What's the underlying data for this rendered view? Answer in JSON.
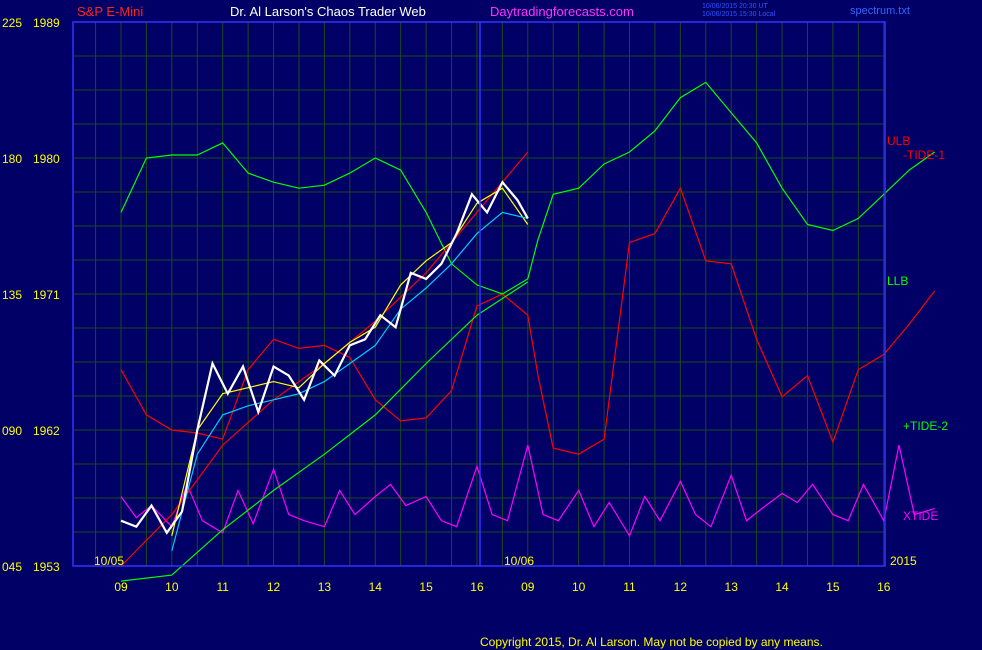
{
  "header": {
    "instrument": "S&P E-Mini",
    "site_title": "Dr. Al Larson's Chaos Trader Web",
    "site_url": "Daytradingforecasts.com",
    "timestamp_utc": "10/06/2015 20:30 UT",
    "timestamp_local": "10/06/2015 15:30 Local",
    "filename": "spectrum.txt"
  },
  "footer": {
    "copyright": "Copyright 2015, Dr. Al Larson. May not be copied by any means."
  },
  "colors": {
    "background": "#000066",
    "plot_border": "#3333ff",
    "grid": "#1c4a1c",
    "tick_label": "#ffff00",
    "price_bars": "#ffffff",
    "tide1": "#ff0000",
    "tide2": "#00ff00",
    "xtide": "#ff00ff",
    "ma_fast": "#ffff00",
    "ma_slow": "#00ccff"
  },
  "chart_data": {
    "type": "line",
    "title": "S&P E-Mini",
    "y_left_outer": {
      "ticks": [
        "225",
        "180",
        "135",
        "090",
        "045"
      ],
      "range": [
        45,
        225
      ]
    },
    "y_left_inner": {
      "ticks": [
        "1989",
        "1980",
        "1971",
        "1962",
        "1953"
      ],
      "range": [
        1953,
        1989
      ]
    },
    "x_ticks": [
      "09",
      "10",
      "11",
      "12",
      "13",
      "14",
      "15",
      "16",
      "09",
      "10",
      "11",
      "12",
      "13",
      "14",
      "15",
      "16"
    ],
    "date_labels": {
      "start": "10/05",
      "divider": "10/06",
      "end": "2015"
    },
    "line_labels": [
      {
        "text": "ULB",
        "color": "#ff0000"
      },
      {
        "text": "-TIDE-1",
        "color": "#ff0000"
      },
      {
        "text": "LLB",
        "color": "#00ff00"
      },
      {
        "text": "+TIDE-2",
        "color": "#00ff00"
      },
      {
        "text": "XTIDE",
        "color": "#ff00ff"
      }
    ],
    "series": [
      {
        "name": "-TIDE-1",
        "x": [
          0,
          0.5,
          1,
          1.5,
          2,
          2.5,
          3,
          3.5,
          4,
          4.5,
          5,
          5.5,
          6,
          6.5,
          7,
          7.5,
          8,
          8.2,
          8.5,
          9,
          9.5,
          10,
          10.5,
          11,
          11.5,
          12,
          12.5,
          13,
          13.5,
          14,
          14.5,
          15,
          15.5,
          16
        ],
        "y": [
          110,
          95,
          90,
          89,
          87,
          110,
          120,
          117,
          118,
          114,
          100,
          93,
          94,
          103,
          131,
          135,
          128,
          108,
          84,
          82,
          87,
          152,
          155,
          170,
          146,
          145,
          120,
          101,
          108,
          86,
          110,
          115,
          125,
          136
        ]
      },
      {
        "name": "+TIDE-2",
        "x": [
          0,
          0.5,
          1,
          1.5,
          2,
          2.5,
          3,
          3.5,
          4,
          4.5,
          5,
          5.5,
          6,
          6.5,
          7,
          7.5,
          8,
          8.2,
          8.5,
          9,
          9.5,
          10,
          10.5,
          11,
          11.5,
          12,
          12.5,
          13,
          13.5,
          14,
          14.5,
          15,
          15.5,
          16
        ],
        "y": [
          162,
          180,
          181,
          181,
          185,
          175,
          172,
          170,
          171,
          175,
          180,
          176,
          162,
          145,
          138,
          135,
          140,
          153,
          168,
          170,
          178,
          182,
          189,
          200,
          205,
          195,
          185,
          170,
          158,
          156,
          160,
          168,
          176,
          182
        ]
      },
      {
        "name": "XTIDE",
        "x": [
          0,
          0.3,
          0.6,
          1,
          1.3,
          1.6,
          2,
          2.3,
          2.6,
          3,
          3.3,
          3.6,
          4,
          4.3,
          4.6,
          5,
          5.3,
          5.6,
          6,
          6.3,
          6.6,
          7,
          7.3,
          7.6,
          8,
          8.3,
          8.6,
          9,
          9.3,
          9.6,
          10,
          10.3,
          10.6,
          11,
          11.3,
          11.6,
          12,
          12.3,
          12.6,
          13,
          13.3,
          13.6,
          14,
          14.3,
          14.6,
          15,
          15.3,
          15.6,
          16
        ],
        "y": [
          68,
          61,
          65,
          58,
          72,
          60,
          56,
          70,
          59,
          77,
          62,
          60,
          58,
          70,
          62,
          68,
          72,
          65,
          68,
          60,
          58,
          78,
          62,
          60,
          85,
          62,
          60,
          70,
          58,
          66,
          55,
          68,
          60,
          73,
          62,
          58,
          75,
          60,
          64,
          69,
          66,
          72,
          62,
          60,
          72,
          60,
          85,
          62,
          64
        ]
      },
      {
        "name": "ULB",
        "x": [
          0,
          1,
          2,
          3,
          4,
          5,
          6,
          7,
          8
        ],
        "y": [
          45,
          62,
          85,
          100,
          112,
          126,
          142,
          162,
          182
        ]
      },
      {
        "name": "LLB",
        "x": [
          0,
          1,
          2,
          3,
          4,
          5,
          6,
          7,
          8
        ],
        "y": [
          40,
          42,
          57,
          70,
          82,
          95,
          112,
          128,
          139
        ]
      },
      {
        "name": "MA-fast",
        "x": [
          1,
          1.5,
          2,
          2.5,
          3,
          3.5,
          4,
          4.5,
          5,
          5.5,
          6,
          6.5,
          7,
          7.5,
          8
        ],
        "y": [
          55,
          90,
          102,
          104,
          106,
          104,
          112,
          119,
          124,
          138,
          146,
          152,
          165,
          170,
          158
        ]
      },
      {
        "name": "MA-slow",
        "x": [
          1,
          1.5,
          2,
          2.5,
          3,
          3.5,
          4,
          4.5,
          5,
          5.5,
          6,
          6.5,
          7,
          7.5,
          8
        ],
        "y": [
          50,
          82,
          95,
          98,
          100,
          102,
          106,
          112,
          118,
          130,
          137,
          145,
          155,
          162,
          160
        ]
      },
      {
        "name": "Price",
        "x": [
          0,
          0.3,
          0.6,
          0.9,
          1.2,
          1.5,
          1.8,
          2.1,
          2.4,
          2.7,
          3,
          3.3,
          3.6,
          3.9,
          4.2,
          4.5,
          4.8,
          5.1,
          5.4,
          5.7,
          6,
          6.3,
          6.6,
          6.9,
          7.2,
          7.5,
          7.8,
          8
        ],
        "y": [
          60,
          58,
          65,
          56,
          63,
          90,
          112,
          102,
          111,
          96,
          111,
          108,
          100,
          113,
          108,
          118,
          120,
          128,
          124,
          142,
          140,
          145,
          155,
          168,
          162,
          172,
          166,
          160
        ]
      }
    ]
  }
}
